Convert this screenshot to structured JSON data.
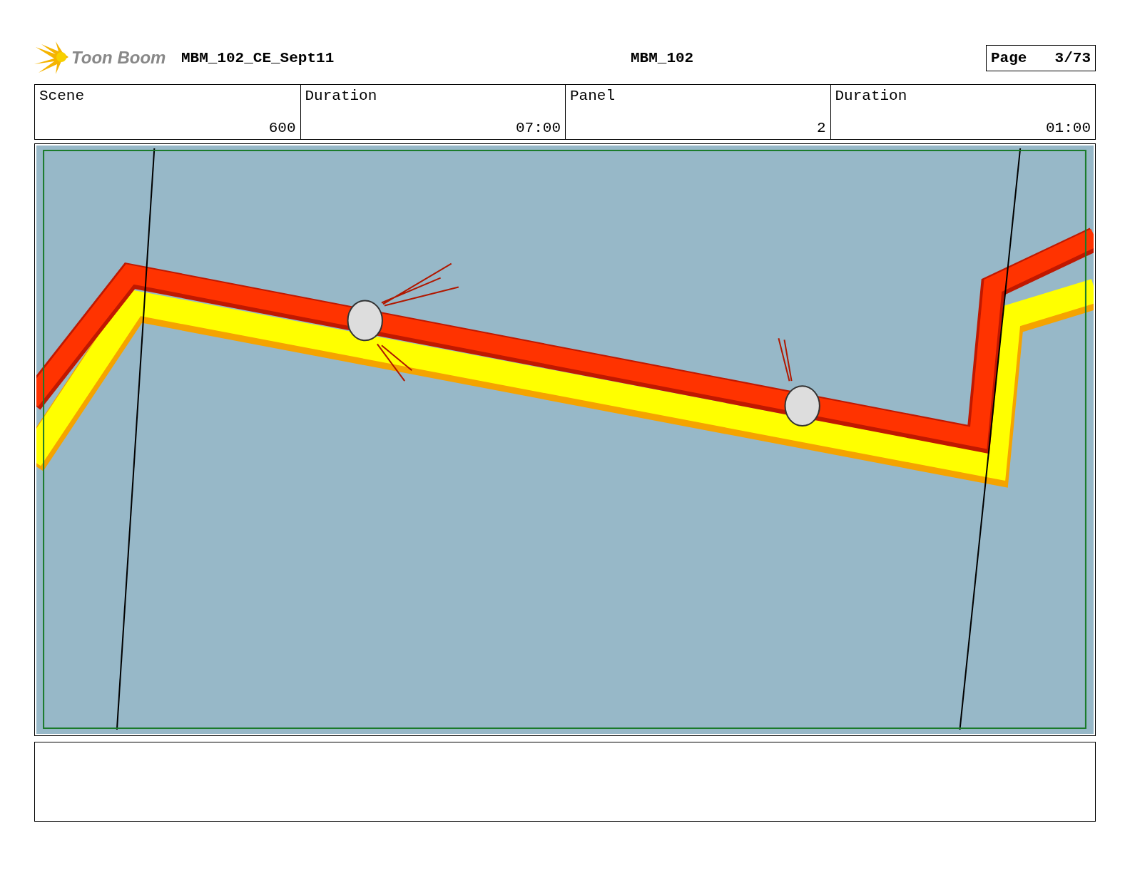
{
  "header": {
    "logo": "Toon Boom",
    "title": "MBM_102_CE_Sept11",
    "project": "MBM_102",
    "page_label": "Page",
    "page": "3/73"
  },
  "info": {
    "labels": [
      "Scene",
      "Duration",
      "Panel",
      "Duration"
    ],
    "values": [
      "600",
      "07:00",
      "2",
      "01:00"
    ]
  }
}
